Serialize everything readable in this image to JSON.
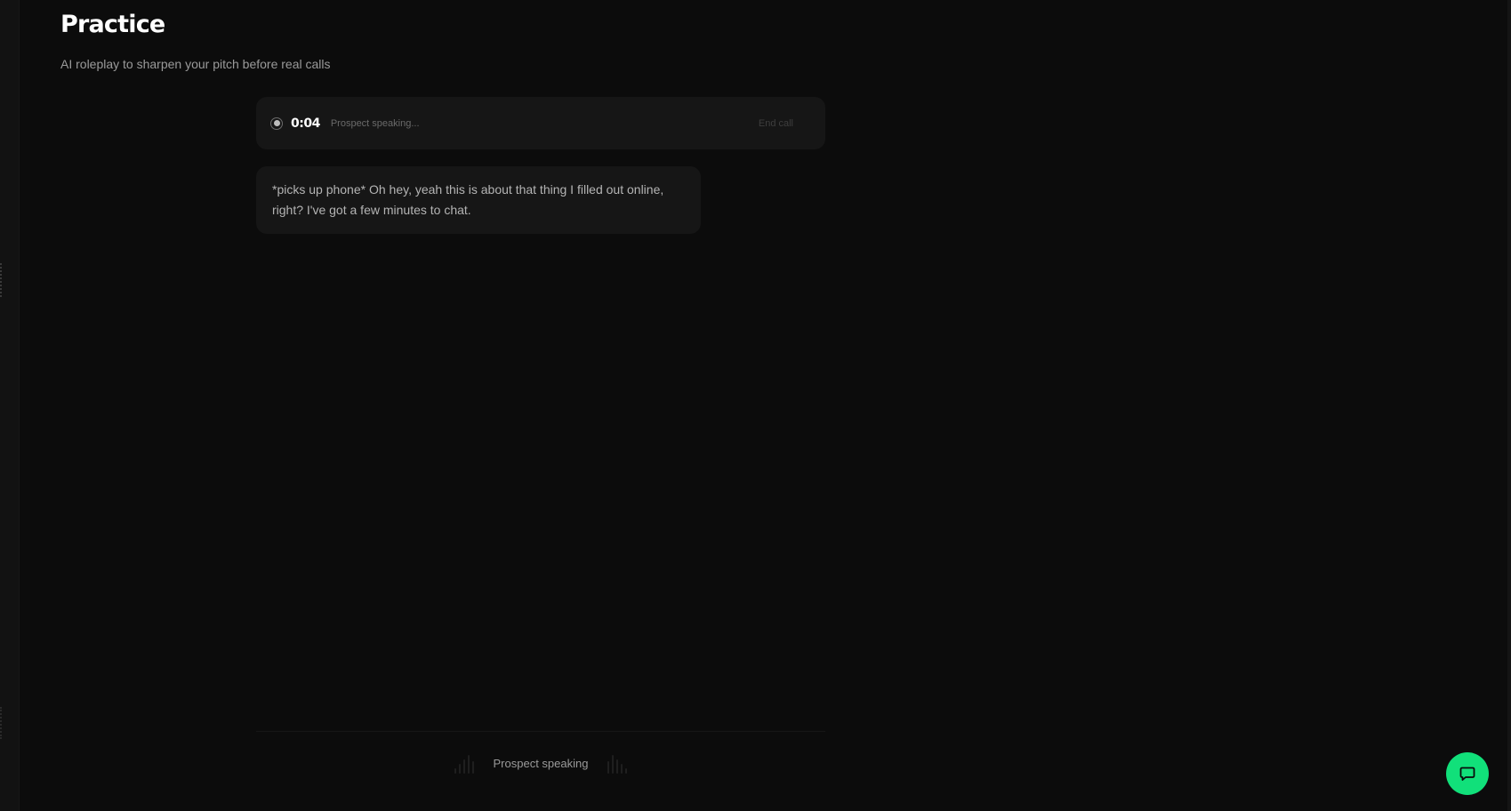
{
  "page": {
    "title": "Practice",
    "subtitle": "AI roleplay to sharpen your pitch before real calls"
  },
  "call": {
    "timer": "0:04",
    "status": "Prospect speaking...",
    "end_call_label": "End call"
  },
  "transcript": [
    {
      "speaker": "prospect",
      "text": "*picks up phone* Oh hey, yeah this is about that thing I filled out online, right? I've got a few minutes to chat."
    }
  ],
  "footer": {
    "speaking_label": "Prospect speaking"
  },
  "icons": {
    "record": "record-dot-icon",
    "chat": "chat-bubble-icon",
    "waveform": "waveform-icon"
  },
  "colors": {
    "background": "#0c0c0c",
    "panel": "#161616",
    "accent": "#11e07a"
  }
}
